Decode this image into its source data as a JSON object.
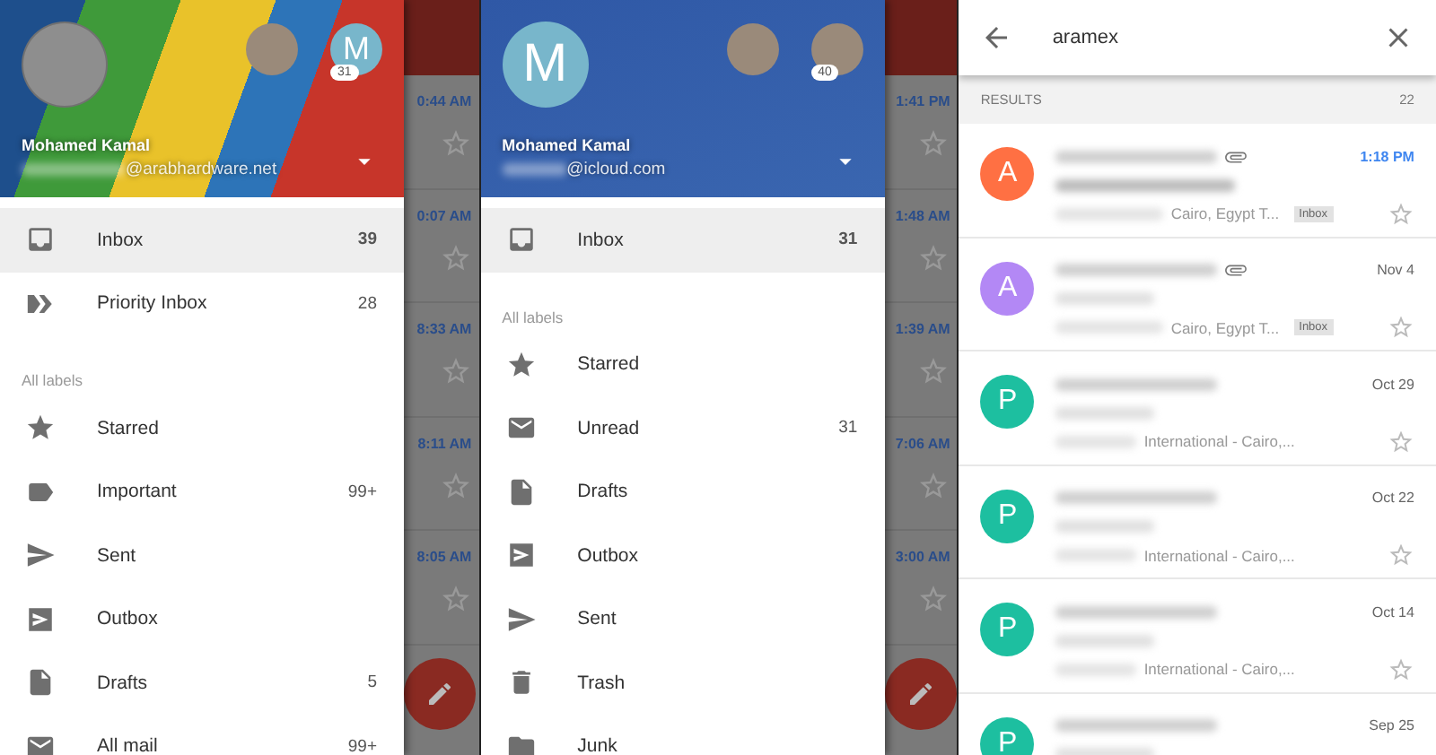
{
  "panels": [
    {
      "kind": "drawer",
      "header": {
        "kind": "material",
        "avatar": {
          "kind": "photo"
        },
        "accounts": [
          {
            "kind": "photo"
          },
          {
            "kind": "letter",
            "letter": "M",
            "badge": "31"
          }
        ],
        "name": "Mohamed Kamal",
        "email": "@arabhardware.net"
      },
      "top_items": [
        {
          "kind": "inbox",
          "label": "Inbox",
          "count": "39",
          "selected": true
        },
        {
          "kind": "priority",
          "label": "Priority Inbox",
          "count": "28",
          "selected": false
        }
      ],
      "labels_heading": "All labels",
      "labels": [
        {
          "kind": "star",
          "label": "Starred"
        },
        {
          "kind": "important",
          "label": "Important",
          "count": "99+"
        },
        {
          "kind": "sent",
          "label": "Sent"
        },
        {
          "kind": "outbox",
          "label": "Outbox"
        },
        {
          "kind": "drafts",
          "label": "Drafts",
          "count": "5"
        },
        {
          "kind": "mail",
          "label": "All mail",
          "count": "99+"
        }
      ],
      "behind_times": [
        "0:44 AM",
        "0:07 AM",
        "8:33 AM",
        "8:11 AM",
        "8:05 AM"
      ]
    },
    {
      "kind": "drawer",
      "header": {
        "kind": "blue",
        "avatar": {
          "kind": "letter",
          "letter": "M"
        },
        "accounts": [
          {
            "kind": "photo"
          },
          {
            "kind": "photo",
            "badge": "40"
          }
        ],
        "name": "Mohamed Kamal",
        "email": "@icloud.com"
      },
      "top_items": [
        {
          "kind": "inbox",
          "label": "Inbox",
          "count": "31",
          "selected": true
        }
      ],
      "labels_heading": "All labels",
      "labels": [
        {
          "kind": "star",
          "label": "Starred"
        },
        {
          "kind": "mail",
          "label": "Unread",
          "count": "31"
        },
        {
          "kind": "drafts",
          "label": "Drafts"
        },
        {
          "kind": "outbox",
          "label": "Outbox"
        },
        {
          "kind": "sent",
          "label": "Sent"
        },
        {
          "kind": "trash",
          "label": "Trash"
        },
        {
          "kind": "folder",
          "label": "Junk"
        }
      ],
      "behind_times": [
        "1:41 PM",
        "1:48 AM",
        "1:39 AM",
        "7:06 AM",
        "3:00 AM"
      ]
    },
    {
      "kind": "search",
      "query": "aramex",
      "results_label": "RESULTS",
      "results_count": "22",
      "results": [
        {
          "letter": "A",
          "color": "#ff7043",
          "date": "1:18 PM",
          "unread": true,
          "attachment": true,
          "tag": "Inbox",
          "snippet": "Cairo, Egypt T..."
        },
        {
          "letter": "A",
          "color": "#b388f5",
          "date": "Nov 4",
          "unread": false,
          "attachment": true,
          "tag": "Inbox",
          "snippet": "Cairo, Egypt T..."
        },
        {
          "letter": "P",
          "color": "#1dbfa0",
          "date": "Oct 29",
          "unread": false,
          "attachment": false,
          "snippet": "International - Cairo,..."
        },
        {
          "letter": "P",
          "color": "#1dbfa0",
          "date": "Oct 22",
          "unread": false,
          "attachment": false,
          "snippet": "International - Cairo,..."
        },
        {
          "letter": "P",
          "color": "#1dbfa0",
          "date": "Oct 14",
          "unread": false,
          "attachment": false,
          "snippet": "International - Cairo,..."
        },
        {
          "letter": "P",
          "color": "#1dbfa0",
          "date": "Sep 25",
          "unread": false,
          "attachment": false
        }
      ]
    }
  ]
}
